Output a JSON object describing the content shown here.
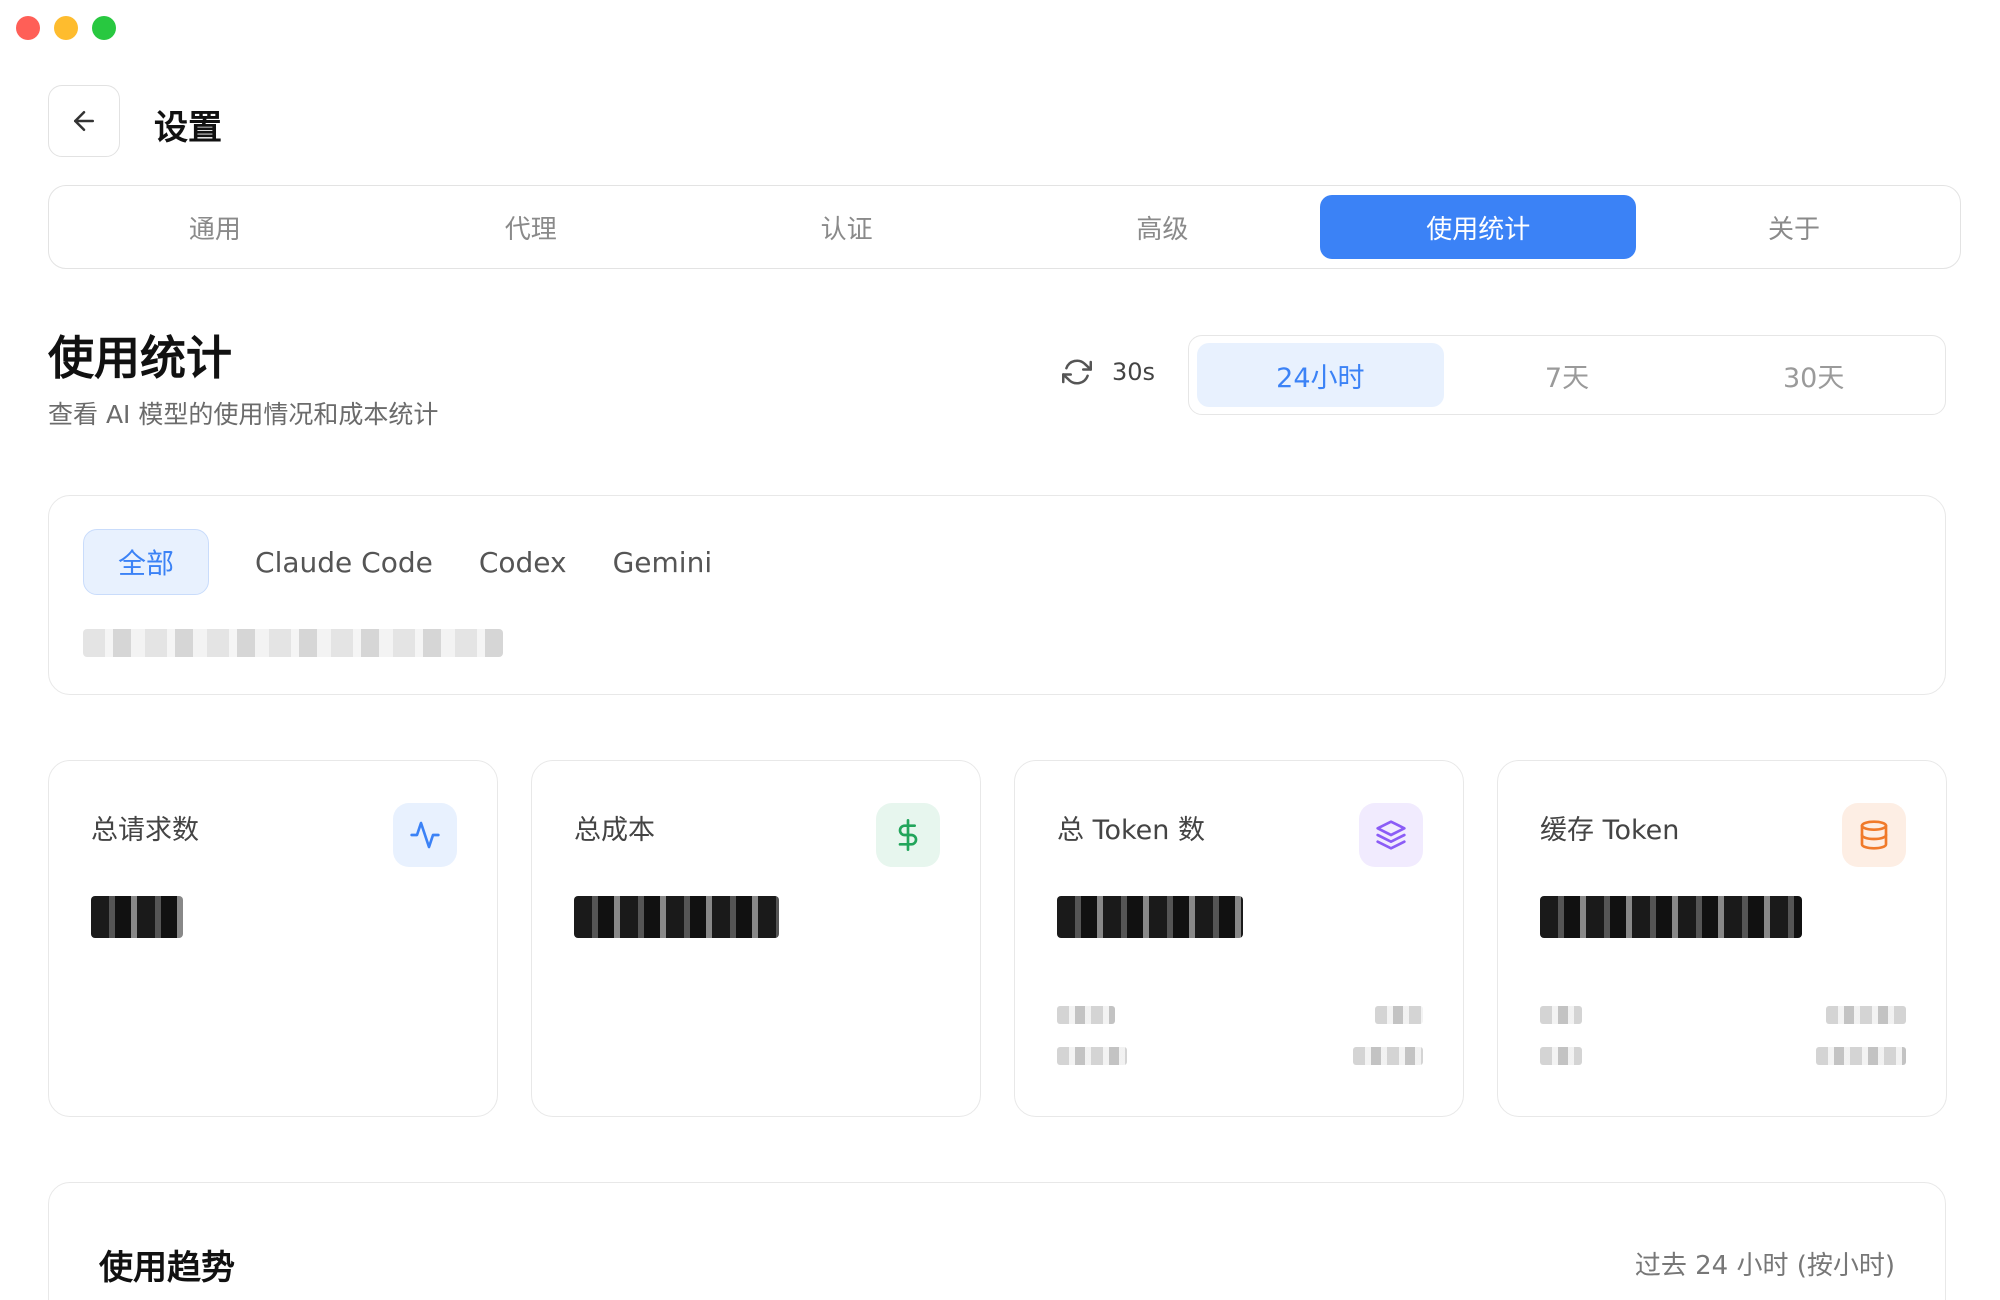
{
  "window": {
    "title": "设置"
  },
  "header": {
    "title": "设置",
    "back_icon": "arrow-left-icon"
  },
  "nav": {
    "tabs": [
      {
        "label": "通用",
        "active": false
      },
      {
        "label": "代理",
        "active": false
      },
      {
        "label": "认证",
        "active": false
      },
      {
        "label": "高级",
        "active": false
      },
      {
        "label": "使用统计",
        "active": true
      },
      {
        "label": "关于",
        "active": false
      }
    ]
  },
  "section": {
    "title": "使用统计",
    "subtitle": "查看 AI 模型的使用情况和成本统计"
  },
  "refresh": {
    "interval": "30s",
    "icon": "refresh-icon"
  },
  "range": {
    "options": [
      {
        "label": "24小时",
        "active": true
      },
      {
        "label": "7天",
        "active": false
      },
      {
        "label": "30天",
        "active": false
      }
    ]
  },
  "filters": {
    "tabs": [
      {
        "label": "全部",
        "active": true
      },
      {
        "label": "Claude Code",
        "active": false
      },
      {
        "label": "Codex",
        "active": false
      },
      {
        "label": "Gemini",
        "active": false
      }
    ]
  },
  "stats": [
    {
      "label": "总请求数",
      "icon": "activity-icon",
      "color": "#3b82f6",
      "bg": "#e8f1fe"
    },
    {
      "label": "总成本",
      "icon": "dollar-icon",
      "color": "#22a55b",
      "bg": "#e7f6ee"
    },
    {
      "label": "总 Token 数",
      "icon": "layers-icon",
      "color": "#8b5cf6",
      "bg": "#f1ebfe"
    },
    {
      "label": "缓存 Token",
      "icon": "database-icon",
      "color": "#f07a2a",
      "bg": "#fdeee4"
    }
  ],
  "trend": {
    "title": "使用趋势",
    "range_label": "过去 24 小时 (按小时)"
  },
  "colors": {
    "accent": "#3b82f6"
  }
}
